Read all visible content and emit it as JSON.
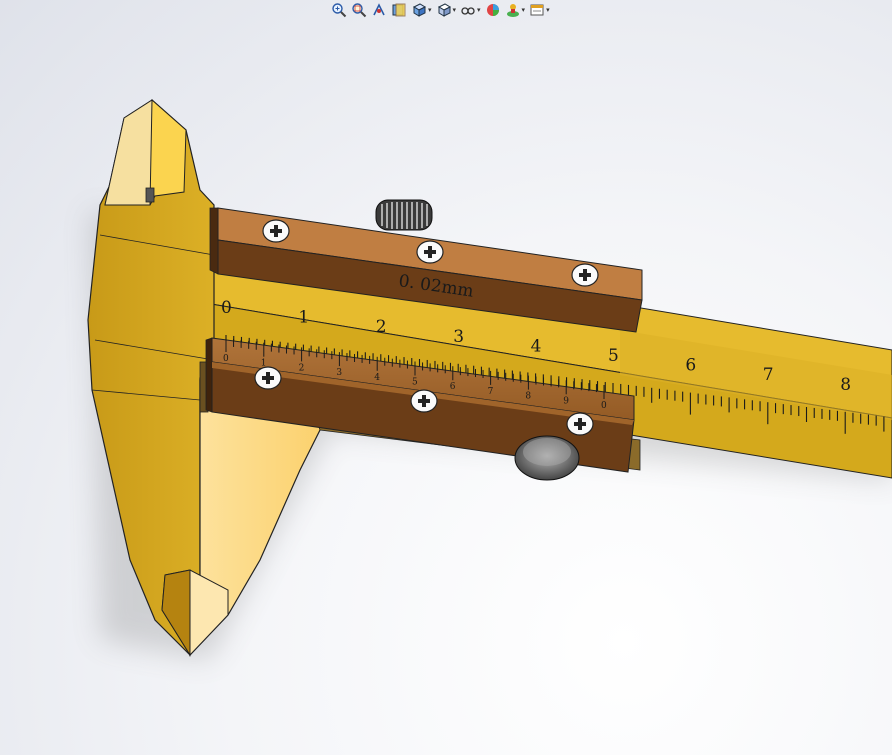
{
  "toolbar": {
    "buttons": [
      {
        "name": "zoom-to-fit-button",
        "icon": "zoom-to-fit-icon",
        "has_dropdown": false
      },
      {
        "name": "zoom-to-area-button",
        "icon": "zoom-to-area-icon",
        "has_dropdown": false
      },
      {
        "name": "previous-view-button",
        "icon": "previous-view-icon",
        "has_dropdown": false
      },
      {
        "name": "section-view-button",
        "icon": "section-view-icon",
        "has_dropdown": false
      },
      {
        "name": "view-orientation-button",
        "icon": "view-orientation-icon",
        "has_dropdown": true
      },
      {
        "name": "display-style-button",
        "icon": "display-style-icon",
        "has_dropdown": true
      },
      {
        "name": "hide-show-items-button",
        "icon": "hide-show-items-icon",
        "has_dropdown": true
      },
      {
        "name": "edit-appearance-button",
        "icon": "edit-appearance-icon",
        "has_dropdown": false
      },
      {
        "name": "apply-scene-button",
        "icon": "apply-scene-icon",
        "has_dropdown": true
      },
      {
        "name": "view-settings-button",
        "icon": "view-settings-icon",
        "has_dropdown": true
      }
    ]
  },
  "model": {
    "precision_label": "0. 02mm",
    "main_scale_numbers": [
      "0",
      "1",
      "2",
      "3",
      "4",
      "5",
      "6",
      "7",
      "8"
    ],
    "vernier_numbers": [
      "0",
      "1",
      "2",
      "3",
      "4",
      "5",
      "6",
      "7",
      "8",
      "9",
      "0"
    ],
    "colors": {
      "body": "#d4a91c",
      "body_light": "#fbd76f",
      "slider": "#a0642a",
      "slider_dark": "#6b3d17",
      "background": "#eef0f4"
    }
  }
}
